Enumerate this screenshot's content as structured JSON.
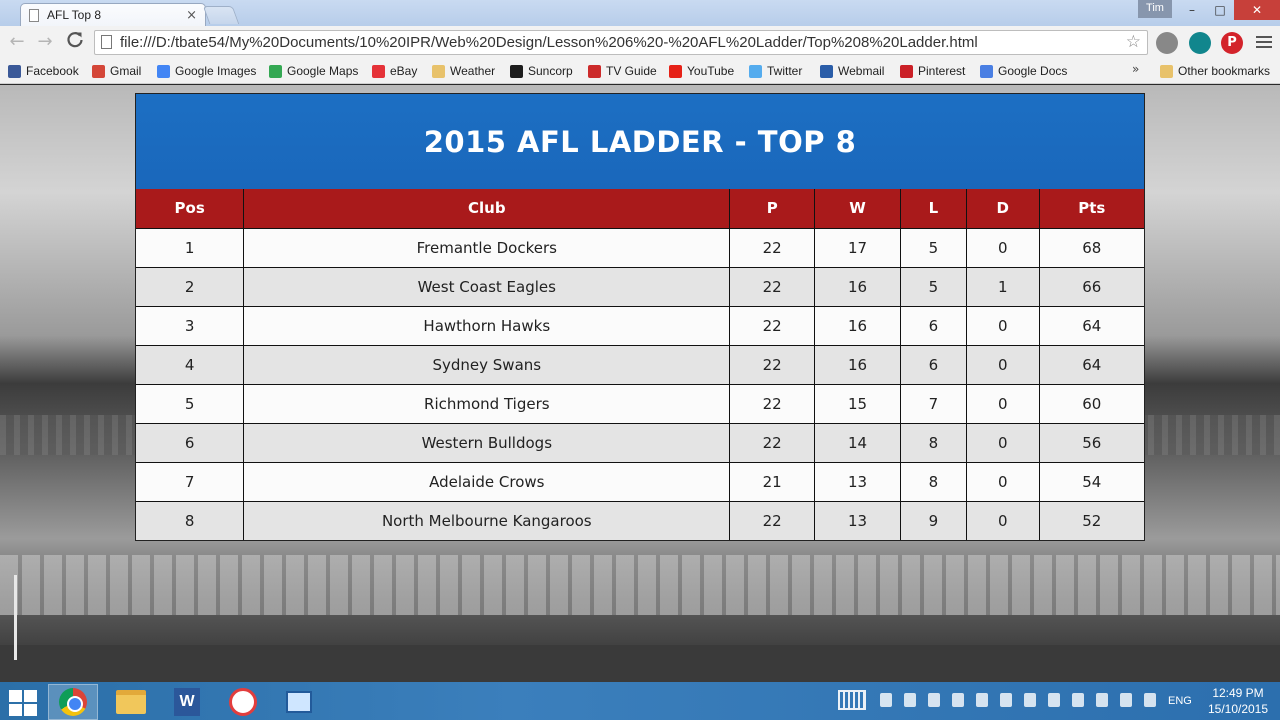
{
  "browser": {
    "tab_title": "AFL Top 8",
    "tab_close": "×",
    "user_name": "Tim",
    "window_controls": {
      "minimize": "–",
      "maximize": "□",
      "close": "✕"
    },
    "url": "file:///D:/tbate54/My%20Documents/10%20IPR/Web%20Design/Lesson%206%20-%20AFL%20Ladder/Top%208%20Ladder.html",
    "nav": {
      "back": "←",
      "forward": "→",
      "reload": "C"
    },
    "star": "☆"
  },
  "bookmarks": {
    "items": [
      {
        "label": "Facebook",
        "icon": "facebook-icon",
        "color": "#3b5998"
      },
      {
        "label": "Gmail",
        "icon": "gmail-icon",
        "color": "#d44638"
      },
      {
        "label": "Google Images",
        "icon": "google-icon",
        "color": "#4285f4"
      },
      {
        "label": "Google Maps",
        "icon": "maps-icon",
        "color": "#34a853"
      },
      {
        "label": "eBay",
        "icon": "ebay-icon",
        "color": "#e53238"
      },
      {
        "label": "Weather",
        "icon": "folder-icon",
        "color": "#e8c26b"
      },
      {
        "label": "Suncorp",
        "icon": "suncorp-icon",
        "color": "#1d1d1d"
      },
      {
        "label": "TV Guide",
        "icon": "tv-icon",
        "color": "#cc2a2a"
      },
      {
        "label": "YouTube",
        "icon": "youtube-icon",
        "color": "#e62117"
      },
      {
        "label": "Twitter",
        "icon": "twitter-icon",
        "color": "#55acee"
      },
      {
        "label": "Webmail",
        "icon": "mail-icon",
        "color": "#2a5da8"
      },
      {
        "label": "Pinterest",
        "icon": "pinterest-icon",
        "color": "#cb2027"
      },
      {
        "label": "Google Docs",
        "icon": "docs-icon",
        "color": "#4a7fe3"
      }
    ],
    "more": "»",
    "other": "Other bookmarks"
  },
  "ladder": {
    "title": "2015 AFL LADDER - TOP 8",
    "columns": [
      "Pos",
      "Club",
      "P",
      "W",
      "L",
      "D",
      "Pts"
    ],
    "rows": [
      [
        "1",
        "Fremantle Dockers",
        "22",
        "17",
        "5",
        "0",
        "68"
      ],
      [
        "2",
        "West Coast Eagles",
        "22",
        "16",
        "5",
        "1",
        "66"
      ],
      [
        "3",
        "Hawthorn Hawks",
        "22",
        "16",
        "6",
        "0",
        "64"
      ],
      [
        "4",
        "Sydney Swans",
        "22",
        "16",
        "6",
        "0",
        "64"
      ],
      [
        "5",
        "Richmond Tigers",
        "22",
        "15",
        "7",
        "0",
        "60"
      ],
      [
        "6",
        "Western Bulldogs",
        "22",
        "14",
        "8",
        "0",
        "56"
      ],
      [
        "7",
        "Adelaide Crows",
        "21",
        "13",
        "8",
        "0",
        "54"
      ],
      [
        "8",
        "North Melbourne Kangaroos",
        "22",
        "13",
        "9",
        "0",
        "52"
      ]
    ],
    "colors": {
      "header": "#1c6fc3",
      "column_header": "#a91a1b"
    }
  },
  "taskbar": {
    "apps": [
      "chrome-icon",
      "file-explorer-icon",
      "word-icon",
      "snipping-tool-icon",
      "remote-desktop-icon"
    ],
    "language": "ENG",
    "time": "12:49 PM",
    "date": "15/10/2015"
  }
}
